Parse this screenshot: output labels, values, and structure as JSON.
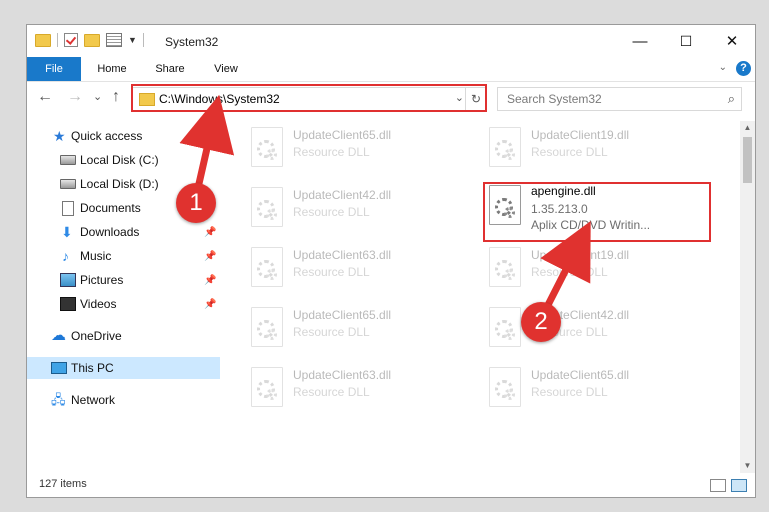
{
  "window": {
    "title": "System32",
    "controls": {
      "minimize": "—",
      "maximize": "☐",
      "close": "✕"
    }
  },
  "ribbon": {
    "tabs": [
      "File",
      "Home",
      "Share",
      "View"
    ],
    "help": "?"
  },
  "nav": {
    "back": "←",
    "forward": "→",
    "recent": "⌄",
    "up": "↑",
    "address": "C:\\Windows\\System32",
    "search_placeholder": "Search System32"
  },
  "sidebar": {
    "items": [
      {
        "label": "Quick access",
        "icon": "star-icon"
      },
      {
        "label": "Local Disk (C:)",
        "icon": "disk-icon"
      },
      {
        "label": "Local Disk (D:)",
        "icon": "disk-icon"
      },
      {
        "label": "Documents",
        "icon": "documents-icon"
      },
      {
        "label": "Downloads",
        "icon": "download-icon"
      },
      {
        "label": "Music",
        "icon": "music-icon"
      },
      {
        "label": "Pictures",
        "icon": "pictures-icon"
      },
      {
        "label": "Videos",
        "icon": "videos-icon"
      },
      {
        "label": "OneDrive",
        "icon": "cloud-icon"
      },
      {
        "label": "This PC",
        "icon": "computer-icon"
      },
      {
        "label": "Network",
        "icon": "network-icon"
      }
    ]
  },
  "files": {
    "items": [
      {
        "name": "UpdateClient65.dll",
        "desc": "Resource DLL"
      },
      {
        "name": "UpdateClient19.dll",
        "desc": "Resource DLL"
      },
      {
        "name": "UpdateClient42.dll",
        "desc": "Resource DLL"
      },
      {
        "name": "apengine.dll",
        "desc": "1.35.213.0",
        "desc2": "Aplix CD/DVD Writin..."
      },
      {
        "name": "UpdateClient63.dll",
        "desc": "Resource DLL"
      },
      {
        "name": "UpdateClient19.dll",
        "desc": "Resource DLL"
      },
      {
        "name": "UpdateClient65.dll",
        "desc": "Resource DLL"
      },
      {
        "name": "UpdateClient42.dll",
        "desc": "Resource DLL"
      },
      {
        "name": "UpdateClient63.dll",
        "desc": "Resource DLL"
      },
      {
        "name": "UpdateClient65.dll",
        "desc": "Resource DLL"
      }
    ]
  },
  "status": {
    "count": "127 items"
  },
  "annotations": {
    "marker1": "1",
    "marker2": "2",
    "color": "#e0322f"
  }
}
